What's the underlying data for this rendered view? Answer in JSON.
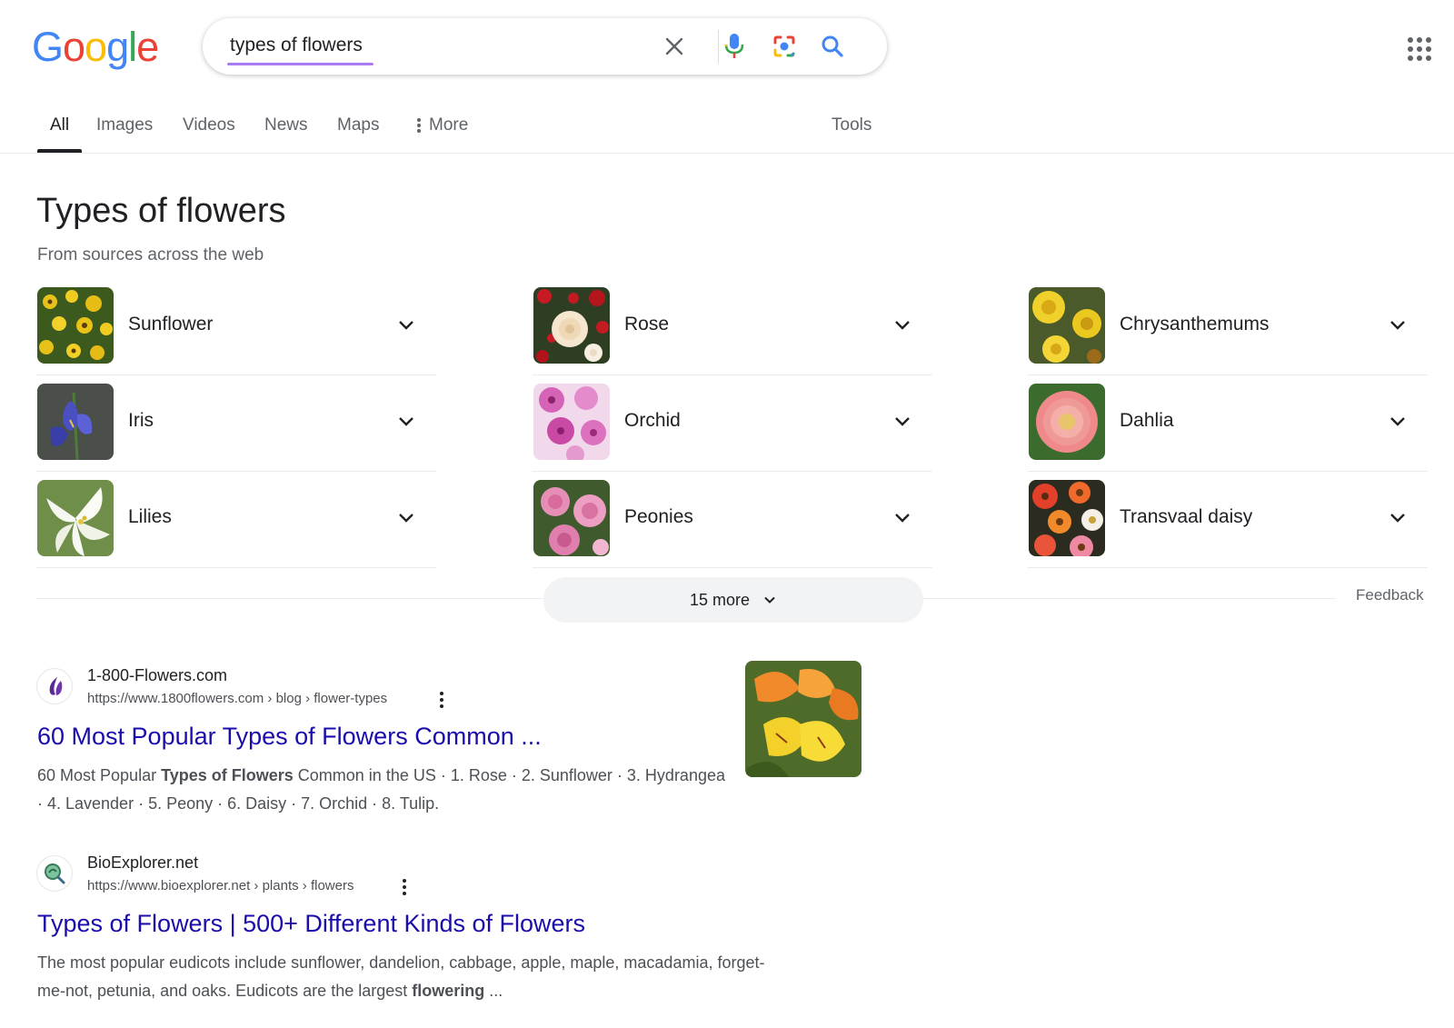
{
  "logo": {
    "text": "Google",
    "letters": [
      "G",
      "o",
      "o",
      "g",
      "l",
      "e"
    ],
    "colors": [
      "#4285F4",
      "#EA4335",
      "#FBBC05",
      "#4285F4",
      "#34A853",
      "#EA4335"
    ]
  },
  "search": {
    "query": "types of flowers",
    "clear_icon": "close-icon",
    "voice_icon": "mic-icon",
    "lens_icon": "lens-icon",
    "search_icon": "search-icon"
  },
  "tabs": [
    {
      "label": "All"
    },
    {
      "label": "Images"
    },
    {
      "label": "Videos"
    },
    {
      "label": "News"
    },
    {
      "label": "Maps"
    },
    {
      "label": "More"
    }
  ],
  "tools_label": "Tools",
  "knowledge": {
    "title": "Types of flowers",
    "subtitle": "From sources across the web",
    "items": [
      {
        "label": "Sunflower"
      },
      {
        "label": "Rose"
      },
      {
        "label": "Chrysanthemums"
      },
      {
        "label": "Iris"
      },
      {
        "label": "Orchid"
      },
      {
        "label": "Dahlia"
      },
      {
        "label": "Lilies"
      },
      {
        "label": "Peonies"
      },
      {
        "label": "Transvaal daisy"
      }
    ],
    "more_label": "15 more",
    "feedback_label": "Feedback"
  },
  "results": [
    {
      "site_name": "1-800-Flowers.com",
      "url": "https://www.1800flowers.com › blog › flower-types",
      "title": "60 Most Popular Types of Flowers Common ...",
      "snippet_pre": "60 Most Popular ",
      "snippet_bold": "Types of Flowers",
      "snippet_post": " Common in the US · 1. Rose · 2. Sunflower · 3. Hydrangea · 4. Lavender · 5. Peony · 6. Daisy · 7. Orchid · 8. Tulip."
    },
    {
      "site_name": "BioExplorer.net",
      "url": "https://www.bioexplorer.net › plants › flowers",
      "title": "Types of Flowers | 500+ Different Kinds of Flowers",
      "snippet_pre": "The most popular eudicots include sunflower, dandelion, cabbage, apple, maple, macadamia, forget-me-not, petunia, and oaks. Eudicots are the largest ",
      "snippet_bold": "flowering",
      "snippet_post": " ..."
    }
  ],
  "colors": {
    "link": "#1a0dab",
    "accent_underline": "#a97cf1",
    "text_secondary": "#5f6368"
  }
}
